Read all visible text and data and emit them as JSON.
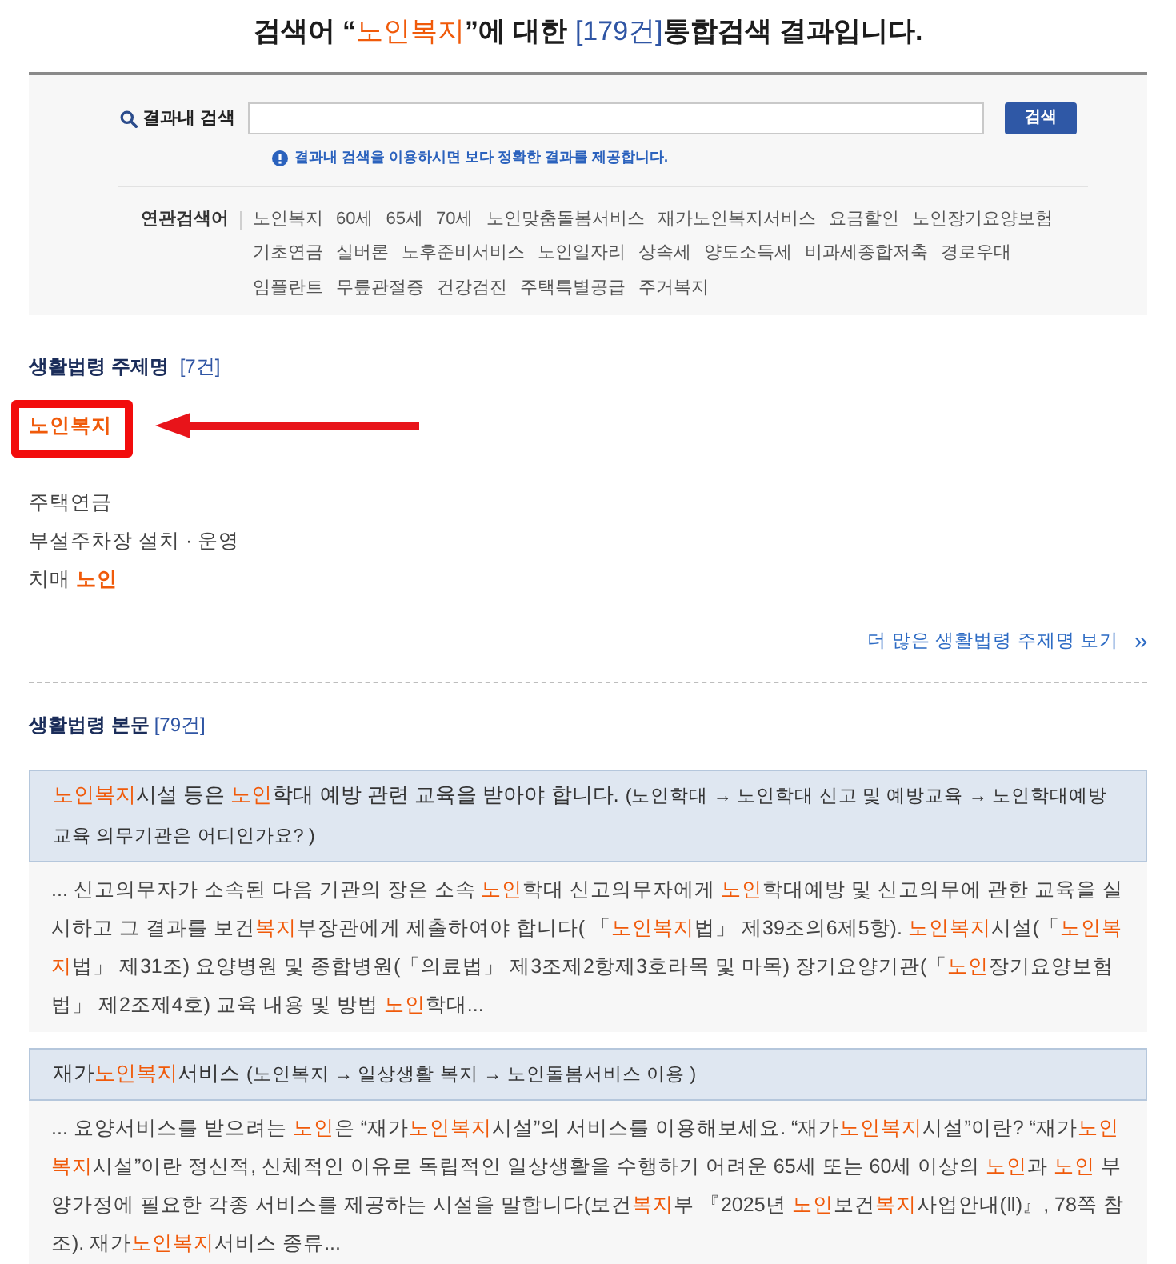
{
  "header": {
    "title": {
      "prefix": "검색어 “",
      "keyword": "노인복지",
      "middle": "”에 대한 ",
      "count": "[179건]",
      "suffix": "통합검색 결과입니다."
    }
  },
  "search_panel": {
    "label": "결과내 검색",
    "button": "검색",
    "notice": "결과내 검색을 이용하시면 보다 정확한 결과를 제공합니다.",
    "related": {
      "label": "연관검색어",
      "keywords": [
        "노인복지",
        "60세",
        "65세",
        "70세",
        "노인맞춤돌봄서비스",
        "재가노인복지서비스",
        "요금할인",
        "노인장기요양보험",
        "기초연금",
        "실버론",
        "노후준비서비스",
        "노인일자리",
        "상속세",
        "양도소득세",
        "비과세종합저축",
        "경로우대",
        "임플란트",
        "무릎관절증",
        "건강검진",
        "주택특별공급",
        "주거복지"
      ]
    }
  },
  "topics": {
    "heading": "생활법령 주제명",
    "count": "[7건]",
    "items": [
      {
        "segments": [
          {
            "text": "노인복지",
            "highlight": true
          }
        ]
      },
      {
        "segments": [
          {
            "text": "주택연금",
            "highlight": false
          }
        ]
      },
      {
        "segments": [
          {
            "text": "부설주차장 설치 · 운영",
            "highlight": false
          }
        ]
      },
      {
        "segments": [
          {
            "text": "치매 ",
            "highlight": false
          },
          {
            "text": "노인",
            "highlight": true
          }
        ]
      }
    ],
    "more_link": "더 많은 생활법령 주제명 보기"
  },
  "body_results": {
    "heading": "생활법령 본문",
    "count": "[79건]",
    "results": [
      {
        "title": [
          {
            "text": "노인복지",
            "highlight": true
          },
          {
            "text": "시설 등은 ",
            "highlight": false
          },
          {
            "text": "노인",
            "highlight": true
          },
          {
            "text": "학대 예방 관련 교육을 받아야 합니다.",
            "highlight": false
          }
        ],
        "path": "(노인학대 → 노인학대 신고 및 예방교육 → 노인학대예방 교육 의무기관은 어디인가요? )",
        "excerpt": [
          {
            "text": "... 신고의무자가 소속된 다음 기관의 장은 소속 ",
            "highlight": false
          },
          {
            "text": "노인",
            "highlight": true
          },
          {
            "text": "학대 신고의무자에게 ",
            "highlight": false
          },
          {
            "text": "노인",
            "highlight": true
          },
          {
            "text": "학대예방 및 신고의무에 관한 교육을 실시하고 그 결과를 보건",
            "highlight": false
          },
          {
            "text": "복지",
            "highlight": true
          },
          {
            "text": "부장관에게 제출하여야 합니다( 「",
            "highlight": false
          },
          {
            "text": "노인복지",
            "highlight": true
          },
          {
            "text": "법」 제39조의6제5항). ",
            "highlight": false
          },
          {
            "text": "노인복지",
            "highlight": true
          },
          {
            "text": "시설(「",
            "highlight": false
          },
          {
            "text": "노인복지",
            "highlight": true
          },
          {
            "text": "법」 제31조) 요양병원 및 종합병원(「의료법」 제3조제2항제3호라목 및 마목) 장기요양기관(「",
            "highlight": false
          },
          {
            "text": "노인",
            "highlight": true
          },
          {
            "text": "장기요양보험법」 제2조제4호) 교육 내용 및 방법 ",
            "highlight": false
          },
          {
            "text": "노인",
            "highlight": true
          },
          {
            "text": "학대...",
            "highlight": false
          }
        ]
      },
      {
        "title": [
          {
            "text": "재가",
            "highlight": false
          },
          {
            "text": "노인복지",
            "highlight": true
          },
          {
            "text": "서비스",
            "highlight": false
          }
        ],
        "path": "(노인복지 → 일상생활 복지 → 노인돌봄서비스 이용 )",
        "excerpt": [
          {
            "text": "... 요양서비스를 받으려는 ",
            "highlight": false
          },
          {
            "text": "노인",
            "highlight": true
          },
          {
            "text": "은 “재가",
            "highlight": false
          },
          {
            "text": "노인복지",
            "highlight": true
          },
          {
            "text": "시설”의 서비스를 이용해보세요. “재가",
            "highlight": false
          },
          {
            "text": "노인복지",
            "highlight": true
          },
          {
            "text": "시설”이란? “재가",
            "highlight": false
          },
          {
            "text": "노인복지",
            "highlight": true
          },
          {
            "text": "시설”이란 정신적, 신체적인 이유로 독립적인 일상생활을 수행하기 어려운 65세 또는 60세 이상의 ",
            "highlight": false
          },
          {
            "text": "노인",
            "highlight": true
          },
          {
            "text": "과 ",
            "highlight": false
          },
          {
            "text": "노인",
            "highlight": true
          },
          {
            "text": " 부양가정에 필요한 각종 서비스를 제공하는 시설을 말합니다(보건",
            "highlight": false
          },
          {
            "text": "복지",
            "highlight": true
          },
          {
            "text": "부 『2025년 ",
            "highlight": false
          },
          {
            "text": "노인",
            "highlight": true
          },
          {
            "text": "보건",
            "highlight": false
          },
          {
            "text": "복지",
            "highlight": true
          },
          {
            "text": "사업안내(Ⅱ)』, 78쪽 참조). 재가",
            "highlight": false
          },
          {
            "text": "노인복지",
            "highlight": true
          },
          {
            "text": "서비스 종류...",
            "highlight": false
          }
        ]
      }
    ]
  }
}
